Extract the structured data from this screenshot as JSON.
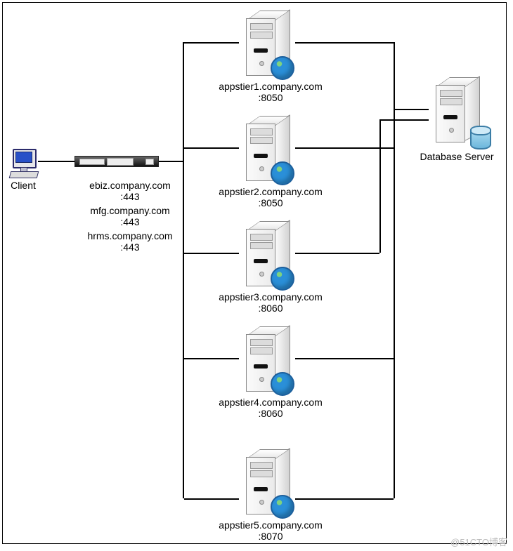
{
  "client": {
    "label": "Client"
  },
  "load_balancer": {
    "entries": [
      {
        "host": "ebiz.company.com",
        "port": ":443"
      },
      {
        "host": "mfg.company.com",
        "port": ":443"
      },
      {
        "host": "hrms.company.com",
        "port": ":443"
      }
    ]
  },
  "app_servers": [
    {
      "host": "appstier1.company.com",
      "port": ":8050"
    },
    {
      "host": "appstier2.company.com",
      "port": ":8050"
    },
    {
      "host": "appstier3.company.com",
      "port": ":8060"
    },
    {
      "host": "appstier4.company.com",
      "port": ":8060"
    },
    {
      "host": "appstier5.company.com",
      "port": ":8070"
    }
  ],
  "database": {
    "label": "Database Server"
  },
  "watermark": "@51CTO博客"
}
